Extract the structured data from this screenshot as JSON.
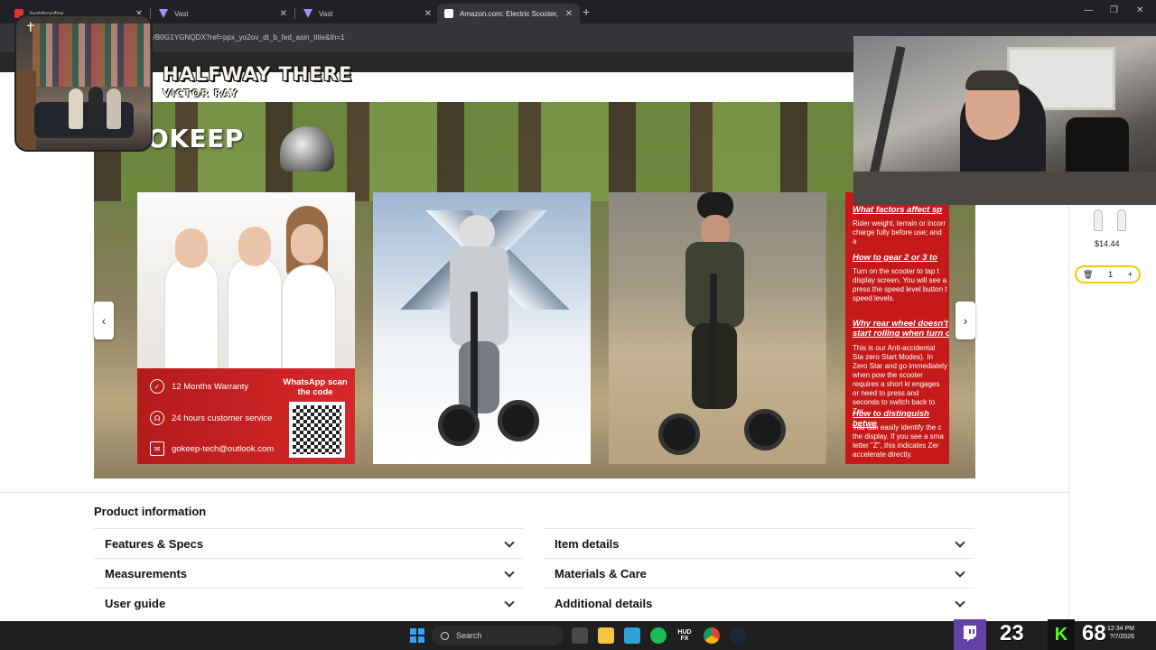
{
  "browser": {
    "tabs": [
      {
        "title": "hotdropfps",
        "active": false
      },
      {
        "title": "Vast",
        "active": false
      },
      {
        "title": "Vast",
        "active": false
      },
      {
        "title": "Amazon.com: Electric Scooter,",
        "active": true
      }
    ],
    "new_tab_icon": "plus-icon",
    "url": "p/B0G1YGNQDX?ref=ppx_yo2ov_dt_b_fed_asin_title&th=1"
  },
  "overlay": {
    "song_title": "HALFWAY THERE",
    "song_artist": "VICTOR RAY",
    "cross_glyph": "✝"
  },
  "carousel": {
    "brand_text": "OKEEP",
    "card1": {
      "rows": [
        {
          "icon": "shield-icon",
          "text": "12 Months Warranty"
        },
        {
          "icon": "headset-icon",
          "text": "24 hours customer service"
        },
        {
          "icon": "mail-icon",
          "text": "gokeep-tech@outlook.com"
        }
      ],
      "whatsapp": "WhatsApp scan the code"
    },
    "card4": {
      "blocks": [
        {
          "head": "What factors affect sp",
          "body": "Rider weight, terrain or incorr charge fully before use; and a"
        },
        {
          "head": "How to gear 2 or 3 to",
          "body": "Turn on the scooter to tap t display screen. You will see a press the speed level button t speed levels."
        },
        {
          "head": "Why rear wheel doesn't start rolling when turn o",
          "body": "This is our Anti-accidental Sta zero Start Modes). In Zero Star and go immediately when pow the scooter requires a short ki engages or need to press and seconds to switch back to Zer"
        },
        {
          "head": "How to distinguish betwe",
          "body": "You can easily identify the c the display. If you see a sma letter \"Z\", this indicates Zer accelerate directly."
        }
      ]
    },
    "prev_icon": "chevron-left-icon",
    "next_icon": "chevron-right-icon"
  },
  "side_cart": {
    "price": "$14.44",
    "quantity": "1",
    "delete_icon": "trash-icon",
    "plus": "+"
  },
  "product_info": {
    "title": "Product information",
    "left_sections": [
      "Features & Specs",
      "Measurements",
      "User guide"
    ],
    "right_sections": [
      "Item details",
      "Materials & Care",
      "Additional details"
    ]
  },
  "taskbar": {
    "search_label": "Search",
    "apps": [
      "start-icon",
      "search-icon",
      "task-view-icon",
      "file-explorer-icon",
      "notepad-icon",
      "spotify-icon",
      "hud-fx-icon",
      "chrome-icon",
      "steam-icon"
    ],
    "hud_label": "HUD\nFX",
    "twitch_count": "23",
    "kick_count": "68",
    "clock_time": "12:34 PM",
    "clock_date": "?/7/2026"
  },
  "colors": {
    "amazon_accent": "#f7ca00",
    "kick_green": "#53fc18",
    "twitch_purple": "#6441a5",
    "card_red": "#c61a1a"
  }
}
